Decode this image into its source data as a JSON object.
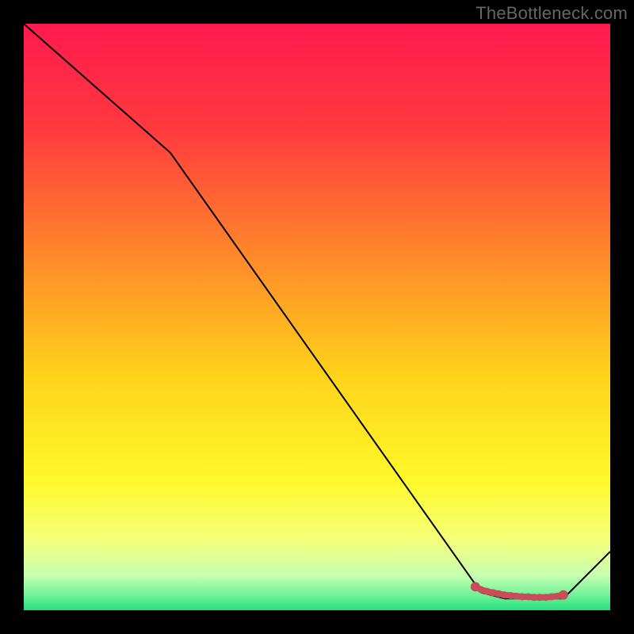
{
  "watermark": "TheBottleneck.com",
  "chart_data": {
    "type": "line",
    "title": "",
    "xlabel": "",
    "ylabel": "",
    "xlim": [
      0,
      100
    ],
    "ylim": [
      0,
      100
    ],
    "series": [
      {
        "name": "bottleneck-curve",
        "stroke": "#000000",
        "x": [
          0,
          25,
          78,
          82,
          88,
          92,
          100
        ],
        "y": [
          100,
          78,
          3,
          2,
          2,
          2,
          10
        ]
      }
    ],
    "markers": {
      "name": "optimal-zone-dots",
      "fill": "#c94d57",
      "x": [
        77,
        78,
        79,
        80,
        81,
        82,
        83,
        84,
        85,
        86,
        87,
        88,
        89,
        90,
        91,
        92
      ],
      "y": [
        4.0,
        3.5,
        3.2,
        3.0,
        2.8,
        2.6,
        2.5,
        2.4,
        2.3,
        2.3,
        2.2,
        2.2,
        2.2,
        2.3,
        2.4,
        2.6
      ]
    },
    "gradient_stops": [
      {
        "offset": 0.0,
        "color": "#ff1a4f"
      },
      {
        "offset": 0.18,
        "color": "#ff3a3e"
      },
      {
        "offset": 0.4,
        "color": "#ff8a2a"
      },
      {
        "offset": 0.6,
        "color": "#ffd31a"
      },
      {
        "offset": 0.78,
        "color": "#fff92a"
      },
      {
        "offset": 0.88,
        "color": "#f4ff7a"
      },
      {
        "offset": 0.94,
        "color": "#c8ffb0"
      },
      {
        "offset": 0.975,
        "color": "#6ef29a"
      },
      {
        "offset": 1.0,
        "color": "#26e07c"
      }
    ]
  }
}
